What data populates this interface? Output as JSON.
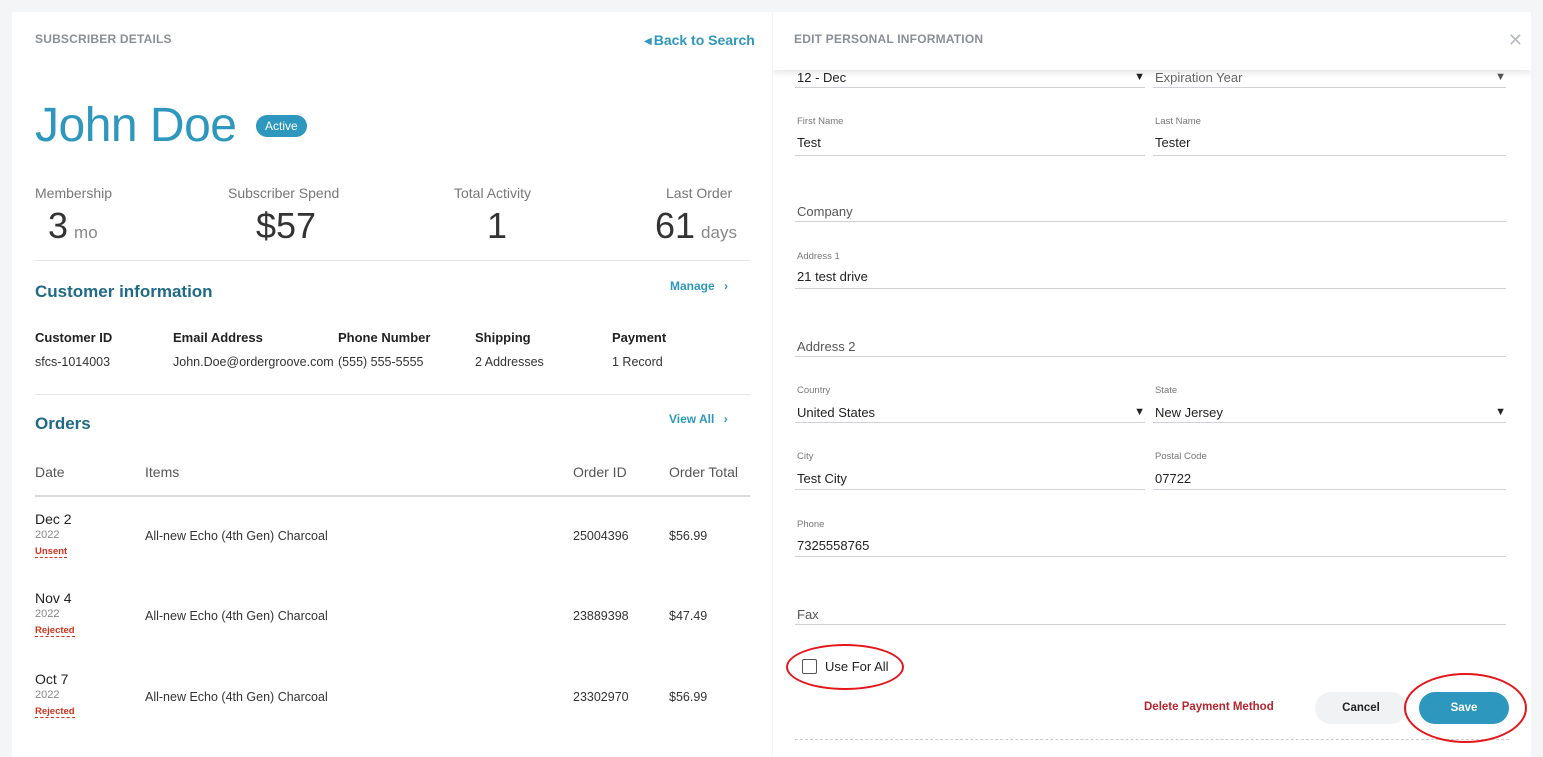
{
  "left": {
    "title": "SUBSCRIBER DETAILS",
    "back_link": "Back to Search",
    "name": "John Doe",
    "status_badge": "Active",
    "stats": [
      {
        "label": "Membership",
        "value": "3",
        "unit": "mo"
      },
      {
        "label": "Subscriber Spend",
        "value": "$57",
        "unit": ""
      },
      {
        "label": "Total Activity",
        "value": "1",
        "unit": ""
      },
      {
        "label": "Last Order",
        "value": "61",
        "unit": "days"
      }
    ],
    "customer": {
      "heading": "Customer information",
      "manage_link": "Manage",
      "columns": [
        {
          "header": "Customer ID",
          "value": "sfcs-1014003"
        },
        {
          "header": "Email Address",
          "value": "John.Doe@ordergroove.com"
        },
        {
          "header": "Phone Number",
          "value": "(555) 555-5555"
        },
        {
          "header": "Shipping",
          "value": "2 Addresses"
        },
        {
          "header": "Payment",
          "value": "1 Record"
        }
      ]
    },
    "orders": {
      "heading": "Orders",
      "view_all_link": "View All",
      "headers": {
        "date": "Date",
        "items": "Items",
        "order_id": "Order ID",
        "order_total": "Order Total"
      },
      "rows": [
        {
          "date": "Dec 2",
          "year": "2022",
          "status": "Unsent",
          "item": "All-new Echo (4th Gen) Charcoal",
          "order_id": "25004396",
          "total": "$56.99"
        },
        {
          "date": "Nov 4",
          "year": "2022",
          "status": "Rejected",
          "item": "All-new Echo (4th Gen) Charcoal",
          "order_id": "23889398",
          "total": "$47.49"
        },
        {
          "date": "Oct 7",
          "year": "2022",
          "status": "Rejected",
          "item": "All-new Echo (4th Gen) Charcoal",
          "order_id": "23302970",
          "total": "$56.99"
        }
      ]
    }
  },
  "right": {
    "title": "EDIT PERSONAL INFORMATION",
    "close_glyph": "✕",
    "fields": {
      "exp_month": {
        "value": "12 - Dec"
      },
      "exp_year": {
        "placeholder": "Expiration Year"
      },
      "first_name": {
        "label": "First Name",
        "value": "Test"
      },
      "last_name": {
        "label": "Last Name",
        "value": "Tester"
      },
      "company": {
        "placeholder": "Company"
      },
      "address1": {
        "label": "Address 1",
        "value": "21 test drive"
      },
      "address2": {
        "placeholder": "Address 2"
      },
      "country": {
        "label": "Country",
        "value": "United States"
      },
      "state": {
        "label": "State",
        "value": "New Jersey"
      },
      "city": {
        "label": "City",
        "value": "Test City"
      },
      "postal": {
        "label": "Postal Code",
        "value": "07722"
      },
      "phone": {
        "label": "Phone",
        "value": "7325558765"
      },
      "fax": {
        "placeholder": "Fax"
      }
    },
    "use_for_all": "Use For All",
    "delete_link": "Delete Payment Method",
    "cancel_label": "Cancel",
    "save_label": "Save"
  },
  "colors": {
    "accent": "#2e97bd",
    "heading": "#1f6a86",
    "danger": "#d0331d",
    "annotation_ring": "#e3161b"
  }
}
